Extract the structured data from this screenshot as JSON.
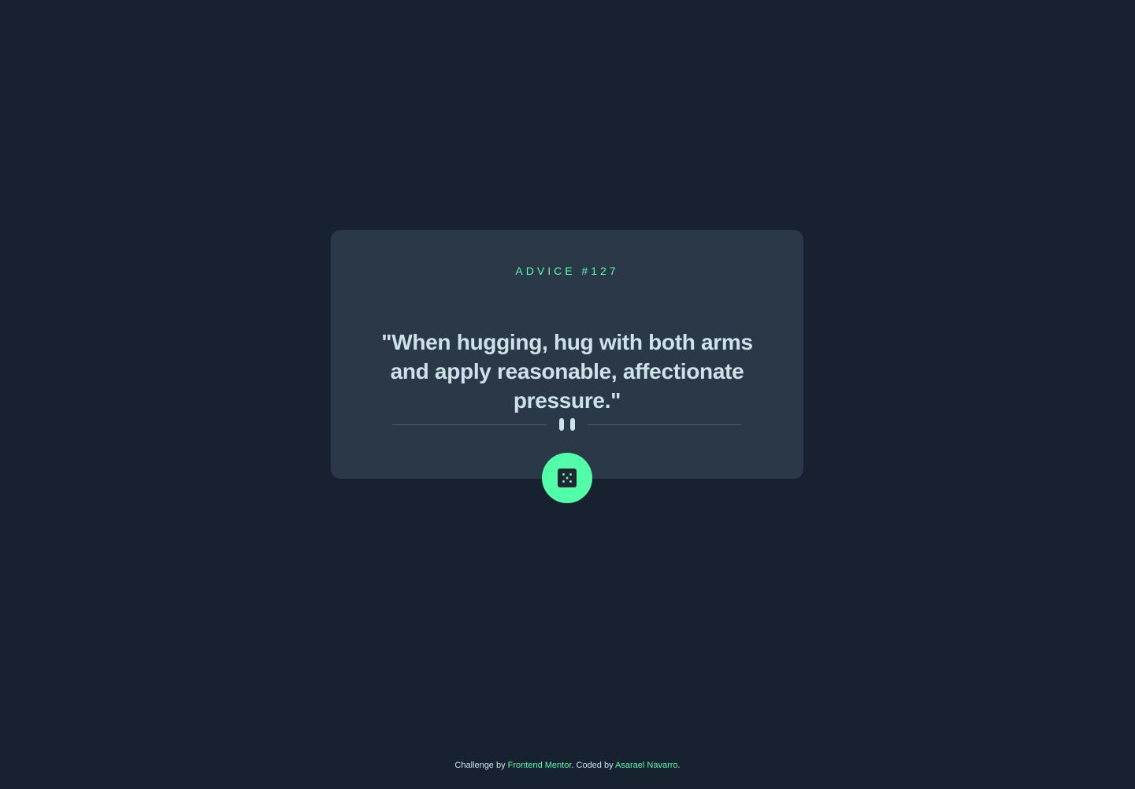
{
  "card": {
    "label": "ADVICE #127",
    "quote": "\"When hugging, hug with both arms and apply reasonable, affectionate pressure.\""
  },
  "icons": {
    "divider": "pause-icon",
    "button": "dice-icon"
  },
  "footer": {
    "prefix": "Challenge by",
    "link1": "Frontend Mentor",
    "middle": ". Coded by",
    "link2": "Asarael Navarro",
    "suffix": "."
  },
  "colors": {
    "background": "#172130",
    "card": "#2b3848",
    "accent": "#52ffa8",
    "text": "#cee3e9",
    "divider": "#4f5d74"
  }
}
